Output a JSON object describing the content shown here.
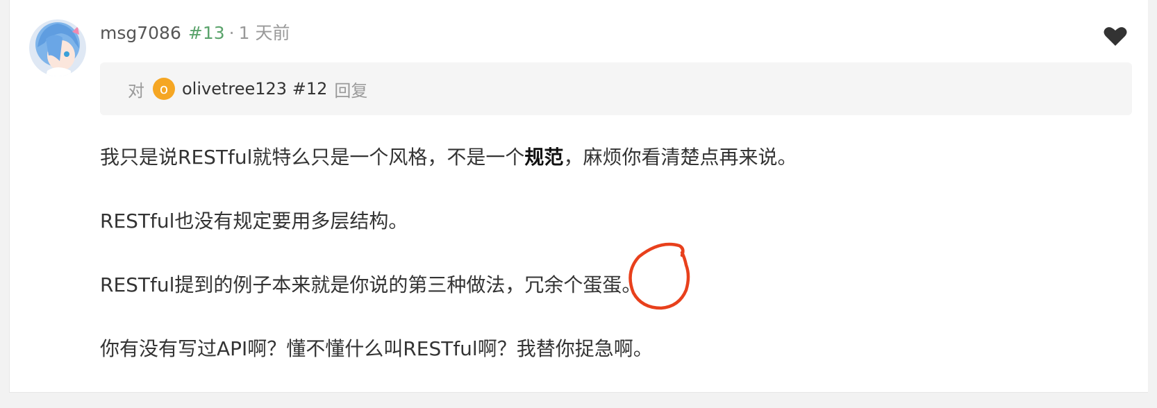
{
  "comment": {
    "username": "msg7086",
    "floor": "#13",
    "separator": "·",
    "time": "1 天前",
    "reply_to": {
      "prefix": "对",
      "avatar_letter": "o",
      "target": "olivetree123 #12",
      "suffix": "回复"
    },
    "paragraphs": [
      {
        "before": "我只是说RESTful就特么只是一个风格，不是一个",
        "bold": "规范",
        "after": "，麻烦你看清楚点再来说。"
      },
      {
        "text": "RESTful也没有规定要用多层结构。"
      },
      {
        "text": "RESTful提到的例子本来就是你说的第三种做法，冗余个蛋蛋。"
      },
      {
        "text": "你有没有写过API啊？懂不懂什么叫RESTful啊？我替你捉急啊。"
      }
    ]
  },
  "icons": {
    "like": "heart-icon",
    "avatar": "user-avatar",
    "annotation": "red-hand-drawn-circle"
  },
  "colors": {
    "floor": "#5aa36b",
    "mini_avatar_bg": "#f5a623",
    "annotation": "#e8401c",
    "reply_box_bg": "#f5f5f5"
  }
}
